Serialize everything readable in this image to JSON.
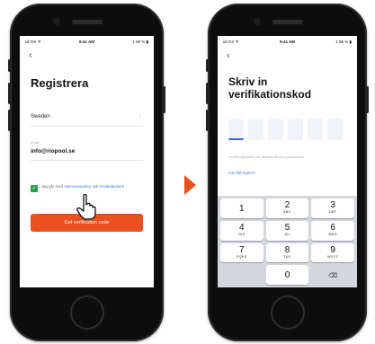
{
  "left_phone": {
    "status": {
      "carrier": "ull GS ᯤ",
      "time": "9:41 AM",
      "battery": "1 98 % ▮"
    },
    "back_label": "‹",
    "title": "Registrera",
    "country": "Sweden",
    "country_chev": "›",
    "email_label": "Email",
    "email_value": "info@riopool.se",
    "agree_check": "✓",
    "agree_text": "Jag går med",
    "agree_link1": "Sekretesspolicy",
    "agree_and": "och",
    "agree_link2": "Användaravtal",
    "cta": "Get verification code"
  },
  "right_phone": {
    "status": {
      "carrier": "ull GS ᯤ",
      "time": "9:41 AM",
      "battery": "1 98 % ▮"
    },
    "back_label": "‹",
    "title_line1": "Skriv in",
    "title_line2": "verifikationskod",
    "hint": "Verifieringskoden har skickats till din e-postadress",
    "resend": "Inte fått koden?",
    "keys": [
      {
        "num": "1",
        "sub": ""
      },
      {
        "num": "2",
        "sub": "ABC"
      },
      {
        "num": "3",
        "sub": "DEF"
      },
      {
        "num": "4",
        "sub": "GHI"
      },
      {
        "num": "5",
        "sub": "JKL"
      },
      {
        "num": "6",
        "sub": "MNO"
      },
      {
        "num": "7",
        "sub": "PQRS"
      },
      {
        "num": "8",
        "sub": "TUV"
      },
      {
        "num": "9",
        "sub": "WXYZ"
      },
      {
        "num": "0",
        "sub": ""
      },
      {
        "num": "⌫",
        "sub": ""
      }
    ]
  },
  "colors": {
    "accent": "#e8501e",
    "check": "#22a447",
    "link": "#3b7bd6"
  }
}
